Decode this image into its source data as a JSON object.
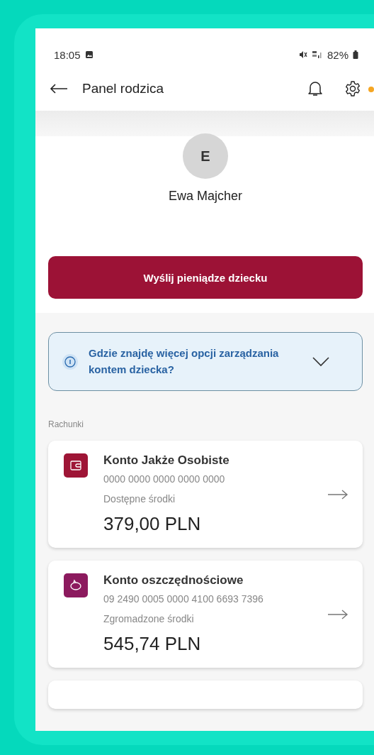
{
  "status_bar": {
    "time": "18:05",
    "battery": "82%"
  },
  "header": {
    "title": "Panel rodzica"
  },
  "profile": {
    "initial": "E",
    "name": "Ewa Majcher"
  },
  "primary_button": {
    "label": "Wyślij pieniądze dziecku"
  },
  "info_box": {
    "text": "Gdzie znajdę więcej opcji zarządzania kontem dziecka?",
    "expanded": false
  },
  "section_label": "Rachunki",
  "accounts": [
    {
      "kind": "wallet",
      "color": "#9e1536",
      "name": "Konto Jakże Osobiste",
      "number": "0000 0000 0000 0000 0000",
      "balance_label": "Dostępne środki",
      "balance": "379,00 PLN"
    },
    {
      "kind": "piggy",
      "color": "#8c1a5e",
      "name": "Konto oszczędnościowe",
      "number": "09 2490 0005 0000 4100 6693 7396",
      "balance_label": "Zgromadzone środki",
      "balance": "545,74 PLN"
    }
  ]
}
